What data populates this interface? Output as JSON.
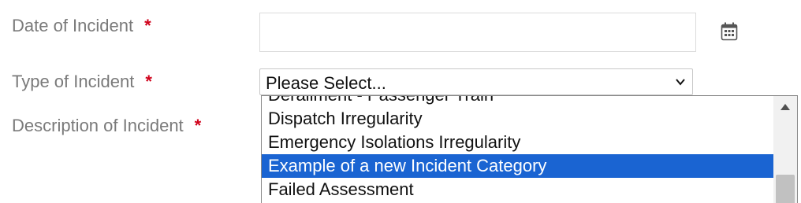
{
  "form": {
    "date_label": "Date of Incident",
    "type_label": "Type of Incident",
    "description_label": "Description of Incident",
    "required_marker": "*",
    "date_value": "",
    "type_select": {
      "selected_value": "Please Select...",
      "options": [
        "Derailment - Passenger Train",
        "Dispatch Irregularity",
        "Emergency Isolations Irregularity",
        "Example of a new Incident Category",
        "Failed Assessment"
      ],
      "highlighted_option": "Example of a new Incident Category"
    }
  },
  "icons": {
    "calendar": "calendar-icon",
    "chevron": "chevron-down-icon",
    "scroll_up": "scroll-up-arrow-icon"
  },
  "colors": {
    "label": "#7a7a7a",
    "required": "#d0021b",
    "highlight": "#1a64d2"
  }
}
